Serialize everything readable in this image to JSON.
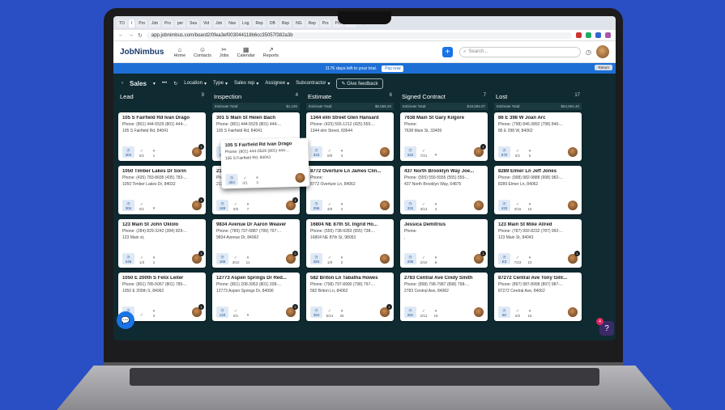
{
  "browser": {
    "tabs": [
      "TO",
      "I",
      "Pro",
      "Job",
      "Pro",
      "per",
      "Sea",
      "Vid",
      "Job",
      "Nav",
      "Log",
      "Rep",
      "OB",
      "Rep",
      "NG",
      "Rep",
      "Pro",
      "Pro",
      "Get"
    ],
    "url": "app.jobnimbus.com/board2/0fea3ef003044118b6cc35057f382a3b"
  },
  "app": {
    "logo": "JobNimbus",
    "nav": [
      {
        "label": "Home",
        "icon": "home-icon"
      },
      {
        "label": "Contacts",
        "icon": "contacts-icon"
      },
      {
        "label": "Jobs",
        "icon": "jobs-icon"
      },
      {
        "label": "Calendar",
        "icon": "calendar-icon"
      },
      {
        "label": "Reports",
        "icon": "reports-icon"
      }
    ],
    "search_placeholder": "Search...",
    "trial_text": "1176 days left in your trial.",
    "pay_now": "Pay now",
    "return_label": "Return"
  },
  "toolbar": {
    "board": "Sales",
    "filters": [
      "Location",
      "Type",
      "Sales rep",
      "Assignee",
      "Subcontractor"
    ],
    "feedback": "Give feedback"
  },
  "columns": [
    {
      "name": "Lead",
      "count": "9",
      "est_label": "",
      "est_value": "",
      "cards": [
        {
          "title": "105 S Fairfield Rd Ivan Drago",
          "phone": "Phone: (801) 444-5529 (801) 444-...",
          "addr": "105 S Fairfield Rd, 84041",
          "badge": "304",
          "s1": "0/1",
          "s2": "1",
          "n": "1"
        },
        {
          "title": "1050 Timber Lakes Dr Sorin",
          "phone": "Phone: (435) 783-8695 (435) 783-...",
          "addr": "1050 Timber Lakes Dr, 84032",
          "badge": "304",
          "s1": "0/1",
          "s2": "",
          "n": "1"
        },
        {
          "title": "123 Main St John Oklolo",
          "phone": "Phone: (284) 829-3242 (284) 829-...",
          "addr": "123 Main st,",
          "badge": "248",
          "s1": "1/3",
          "s2": "1",
          "n": "1"
        },
        {
          "title": "1050 E 200th S Felix Leiter",
          "phone": "Phone: (801) 785-5067 (801) 785-...",
          "addr": "1050 E 200th S, 84062",
          "badge": "304",
          "s1": "",
          "s2": "3",
          "n": "1"
        }
      ]
    },
    {
      "name": "Inspection",
      "count": "4",
      "est_label": "Estimate Total:",
      "est_value": "$1,100",
      "cards": [
        {
          "title": "301 S Main St Helen Bach",
          "phone": "Phone: (801) 444-5529 (801) 444-...",
          "addr": "105 S Fairfield Rd, 84041",
          "badge": "304",
          "s1": "0/1",
          "s2": "3",
          "n": ""
        },
        {
          "title": "2113 Main St Jessica Lamp",
          "phone": "Phone:",
          "addr": "2113 Main St, 94807",
          "badge": "189",
          "s1": "0/5",
          "s2": "7",
          "n": "1"
        },
        {
          "title": "9834 Avenue Dr Aaron Weaver",
          "phone": "Phone: (789) 797-0887 (789) 797-...",
          "addr": "9834 Avenue Dr, 84062",
          "badge": "189",
          "s1": "3/10",
          "s2": "11",
          "n": "2"
        },
        {
          "title": "12773 Aspen Springs Dr Red...",
          "phone": "Phone: (801) 208-3953 (801) 208-...",
          "addr": "12773 Aspen Springs Dr, 84096",
          "badge": "133",
          "s1": "0/1",
          "s2": "",
          "n": "2"
        }
      ]
    },
    {
      "name": "Estimate",
      "count": "6",
      "est_label": "Estimate Total:",
      "est_value": "$6,558.20",
      "cards": [
        {
          "title": "1344 elm Street Glen Hansard",
          "phone": "Phone: (425) 555-1212 (425) 555-...",
          "addr": "1344 elm Street, 83644",
          "badge": "333",
          "s1": "0/9",
          "s2": "3",
          "n": ""
        },
        {
          "title": "8772 Overture Ln James Clin...",
          "phone": "Phone:",
          "addr": "8772 Overture Ln, 84062",
          "badge": "296",
          "s1": "4/9",
          "s2": "2",
          "n": ""
        },
        {
          "title": "16804 NE 87th St. Ingrid Ho...",
          "phone": "Phone: (555) 738-9283 (555) 738-...",
          "addr": "16804 NE 87th St, 98053",
          "badge": "284",
          "s1": "1/9",
          "s2": "2",
          "n": ""
        },
        {
          "title": "582 Briton Ln Tabatha Howes",
          "phone": "Phone: (798) 797-8990 (798) 797-...",
          "addr": "582 Briton Ln, 84062",
          "badge": "284",
          "s1": "5/14",
          "s2": "25",
          "n": "1"
        }
      ]
    },
    {
      "name": "Signed Contract",
      "count": "7",
      "est_label": "Estimate Total:",
      "est_value": "$19,565.07",
      "cards": [
        {
          "title": "7638 Main St Gary Kilgore",
          "phone": "Phone:",
          "addr": "7638 Main St, 33409",
          "badge": "332",
          "s1": "7/21",
          "s2": "",
          "n": "1"
        },
        {
          "title": "437 North Brooklyn Way Joe...",
          "phone": "Phone: (555) 555-5555 (555) 555-...",
          "addr": "437 North Brooklyn Way, 64875",
          "badge": "332",
          "s1": "3/12",
          "s2": "3",
          "n": ""
        },
        {
          "title": "Jessica Demitrius",
          "phone": "Phone:",
          "addr": ",",
          "badge": "296",
          "s1": "2/10",
          "s2": "6",
          "n": "1"
        },
        {
          "title": "2783 Central Ave Cindy Smith",
          "phone": "Phone: (898) 798-7987 (898) 798-...",
          "addr": "2783 Central Ave, 84062",
          "badge": "281",
          "s1": "2/12",
          "s2": "19",
          "n": ""
        }
      ]
    },
    {
      "name": "Lost",
      "count": "17",
      "est_label": "Estimate Total:",
      "est_value": "$64,904.40",
      "cards": [
        {
          "title": "86 E 398 W Joan Arc",
          "phone": "Phone: (798) 846-3892 (798) 846-...",
          "addr": "86 E 398 W, 84062",
          "badge": "670",
          "s1": "0/1",
          "s2": "6",
          "n": ""
        },
        {
          "title": "8289 Elmer Ln Jeff Jones",
          "phone": "Phone: (998) 982-9888 (998) 982-...",
          "addr": "8289 Elmer Ln, 84062",
          "badge": "433",
          "s1": "3/15",
          "s2": "15",
          "n": ""
        },
        {
          "title": "123 Main St Mike Allred",
          "phone": "Phone: (787) 992-8232 (787) 992-...",
          "addr": "123 Main St, 84043",
          "badge": "E3",
          "s1": "7/23",
          "s2": "10",
          "n": "1"
        },
        {
          "title": "87272 Central Ave Tony Gillr...",
          "phone": "Phone: (897) 987-8998 (897) 987-...",
          "addr": "87272 Central Ave, 84062",
          "badge": "80",
          "s1": "0/2",
          "s2": "15",
          "n": ""
        }
      ]
    }
  ],
  "dragged": {
    "title": "105 S Fairfield Rd Ivan Drago",
    "phone": "Phone: (801) 444-5529 (801) 444-...",
    "addr": "105 S Fairfield Rd, 84041",
    "badge": "304",
    "s1": "0/1",
    "s2": "3"
  },
  "help_badge": "4"
}
